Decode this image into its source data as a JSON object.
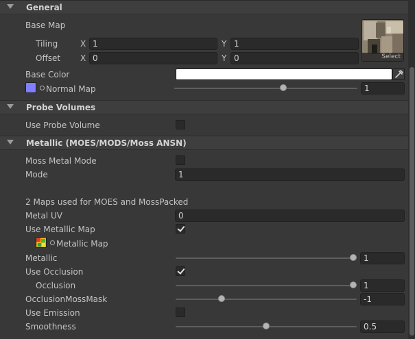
{
  "sections": {
    "general": {
      "title": "General"
    },
    "probe": {
      "title": "Probe Volumes"
    },
    "metallic": {
      "title": "Metallic (MOES/MODS/Moss ANSN)"
    }
  },
  "general": {
    "base_map_label": "Base Map",
    "tiling_label": "Tiling",
    "offset_label": "Offset",
    "x_label": "X",
    "y_label": "Y",
    "tiling_x": "1",
    "tiling_y": "1",
    "offset_x": "0",
    "offset_y": "0",
    "texture_select": "Select",
    "base_color_label": "Base Color",
    "base_color": "#ffffff",
    "normal_map_label": "Normal Map",
    "normal_map_swatch": "#8080ff",
    "normal_map_value": "1",
    "normal_map_level": 0.6
  },
  "probe": {
    "use_probe_volume_label": "Use Probe Volume",
    "use_probe_volume": false
  },
  "metallic": {
    "moss_metal_mode_label": "Moss Metal Mode",
    "moss_metal_mode": false,
    "mode_label": "Mode",
    "mode_value": "1",
    "info_text": "2 Maps used for MOES and MossPacked",
    "metal_uv_label": "Metal UV",
    "metal_uv_value": "0",
    "use_metallic_map_label": "Use Metallic Map",
    "use_metallic_map": true,
    "metallic_map_label": "Metallic Map",
    "metallic_label": "Metallic",
    "metallic_value": "1",
    "metallic_level": 1.0,
    "use_occlusion_label": "Use Occlusion",
    "use_occlusion": true,
    "occlusion_label": "Occlusion",
    "occlusion_value": "1",
    "occlusion_level": 1.0,
    "occlusion_moss_mask_label": "OcclusionMossMask",
    "occlusion_moss_mask_value": "-1",
    "occlusion_moss_mask_level": 0.26,
    "use_emission_label": "Use Emission",
    "use_emission": false,
    "smoothness_label": "Smoothness",
    "smoothness_value": "0.5",
    "smoothness_level": 0.5
  },
  "icons": {
    "foldout": "triangle-down",
    "picker": "eyedropper-icon",
    "texture_ring": "circle-icon"
  }
}
